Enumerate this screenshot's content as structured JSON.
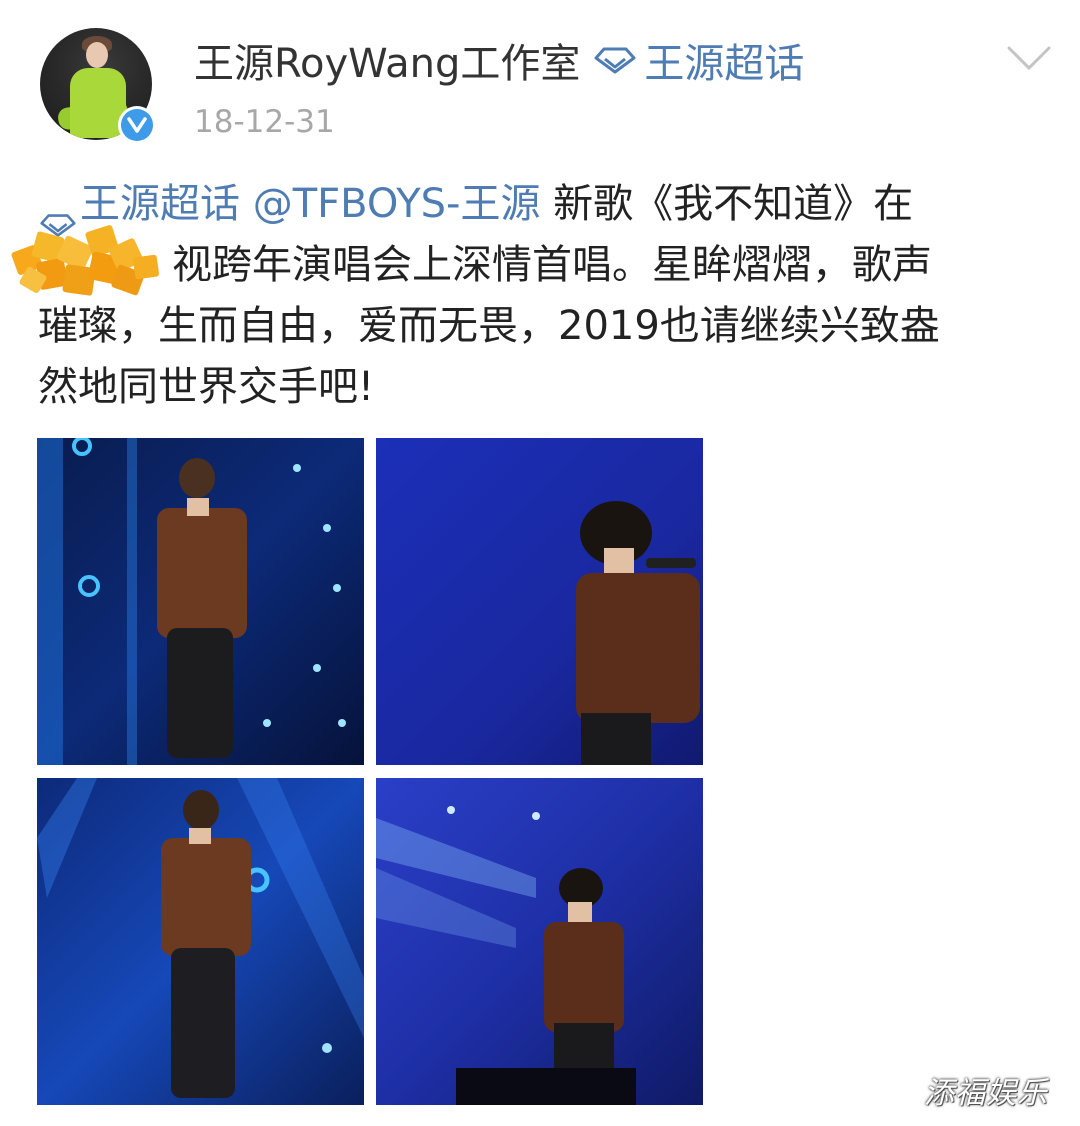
{
  "post": {
    "username": "王源RoyWang工作室",
    "topic_link": "王源超话",
    "timestamp": "18-12-31",
    "text": {
      "topic_tag": "王源超话",
      "mention": "@TFBOYS-王源",
      "line1_rest": " 新歌《我不知道》在",
      "line2": "视跨年演唱会上深情首唱。星眸熠熠，歌声",
      "line3": "璀璨，生而自由，爱而无畏，2019也请继续兴致盎",
      "line4": "然地同世界交手吧!"
    },
    "photos": [
      {
        "alt": "stage-photo-1"
      },
      {
        "alt": "stage-photo-2"
      },
      {
        "alt": "stage-photo-3"
      },
      {
        "alt": "stage-photo-4"
      }
    ]
  },
  "watermark": "添福娱乐",
  "icons": {
    "topic": "diamond-topic-icon",
    "verified": "verified-check-icon",
    "more": "chevron-down-icon"
  },
  "colors": {
    "link": "#4f7db3",
    "verified": "#3d9be9",
    "text": "#222222",
    "timestamp": "#a7a7a7"
  }
}
